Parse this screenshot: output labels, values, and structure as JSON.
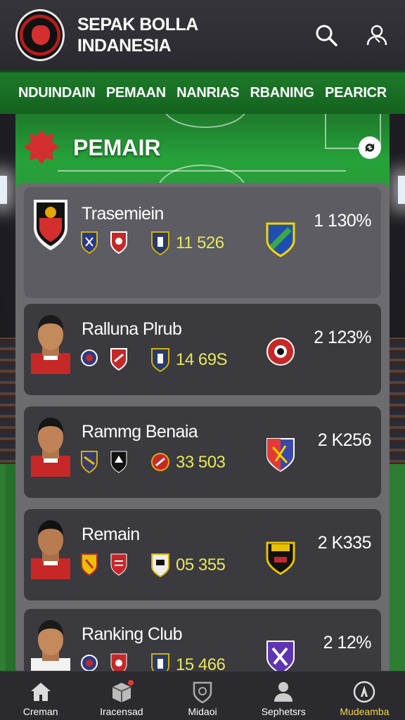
{
  "app": {
    "title": "SEPAK BOLLA\nINDANESIA"
  },
  "header": {
    "icons": [
      "search-icon",
      "user-icon"
    ]
  },
  "nav": {
    "tabs": [
      {
        "label": "NDUINDAIN"
      },
      {
        "label": "PEMAAN"
      },
      {
        "label": "NANRIAS"
      },
      {
        "label": "RBANING"
      },
      {
        "label": "PEARICR"
      }
    ]
  },
  "section": {
    "title": "PEMAIR",
    "icon": "star-badge-icon",
    "action_icon": "refresh-icon"
  },
  "players": [
    {
      "name": "Trasemiein",
      "stat": "11 526",
      "rank": "1  130%",
      "avatar": "club-crest-icon",
      "club_color": "#1e4fb0",
      "club_color2": "#f5d400"
    },
    {
      "name": "Ralluna Plrub",
      "stat": "14 69S",
      "rank": "2  123%",
      "avatar": "player-photo",
      "club_color": "#c62828",
      "club_color2": "#fff"
    },
    {
      "name": "Rammg Benaia",
      "stat": "33 503",
      "rank": "2  K256",
      "avatar": "player-photo",
      "club_color": "#3949ab",
      "club_color2": "#e53935"
    },
    {
      "name": "Remain",
      "stat": "05 355",
      "rank": "2  K335",
      "avatar": "player-photo",
      "club_color": "#111",
      "club_color2": "#e6c200"
    },
    {
      "name": "Ranking Club",
      "stat": "15 466",
      "rank": "2  12%",
      "avatar": "player-photo",
      "club_color": "#5e35b1",
      "club_color2": "#fff"
    }
  ],
  "bottom_nav": [
    {
      "label": "Creman",
      "icon": "home-icon",
      "active": false
    },
    {
      "label": "Iracensad",
      "icon": "box-icon",
      "active": false
    },
    {
      "label": "Midaoi",
      "icon": "shield-icon",
      "active": false
    },
    {
      "label": "Sephetsrs",
      "icon": "person-icon",
      "active": false
    },
    {
      "label": "Mudeamba",
      "icon": "compass-icon",
      "active": true
    }
  ]
}
